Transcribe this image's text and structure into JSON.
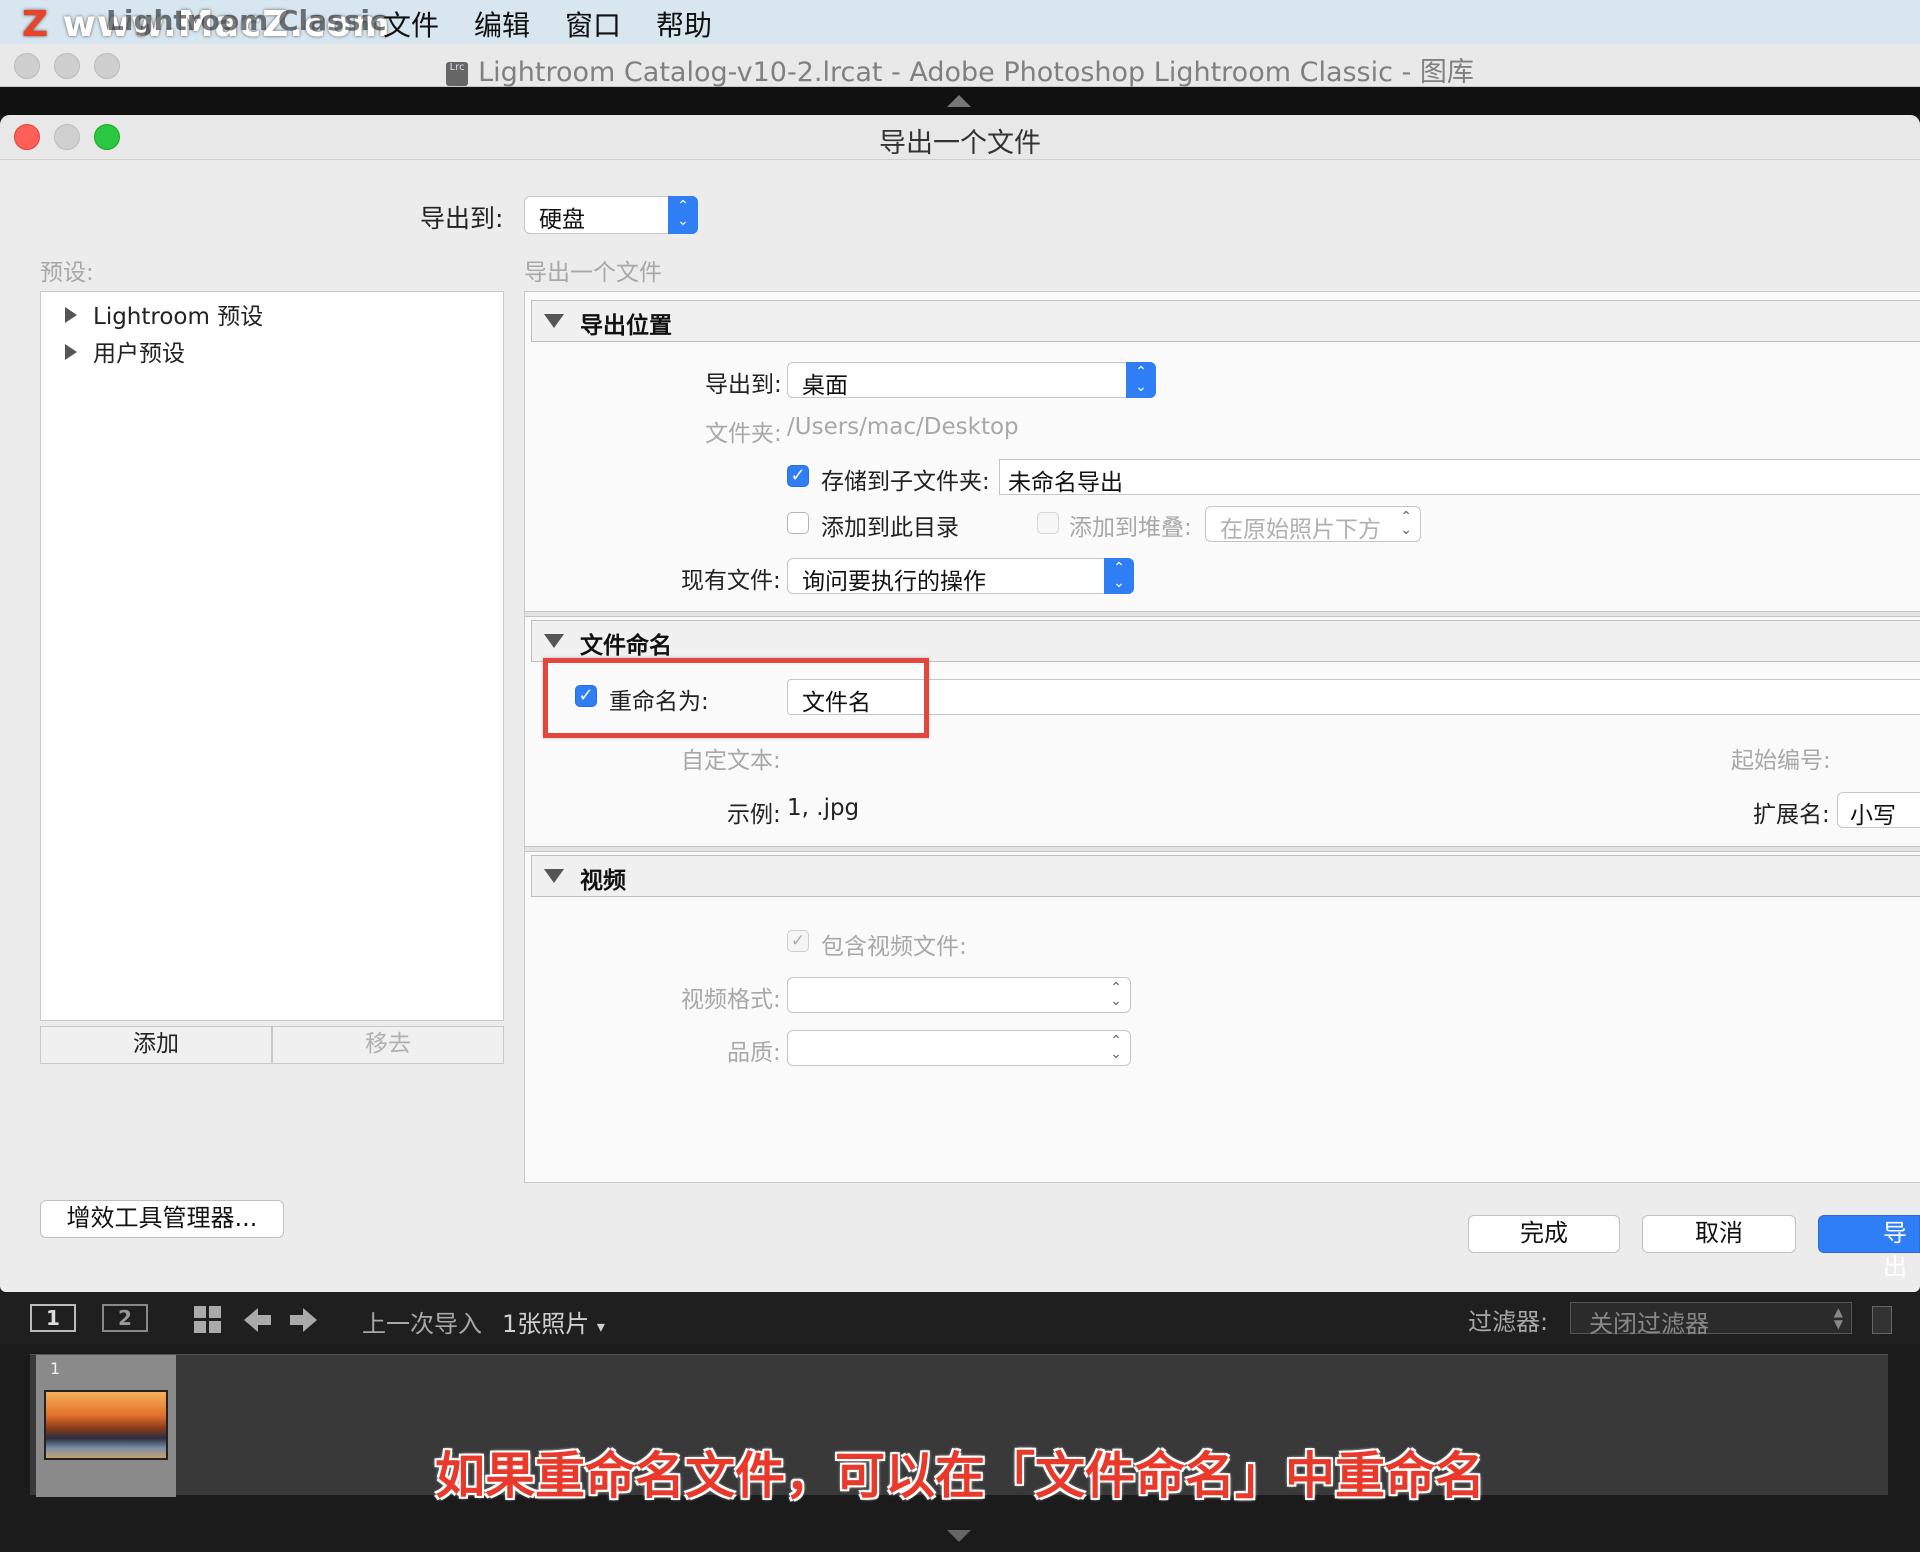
{
  "menubar": {
    "app_name": "Lightroom Classic",
    "watermark": "www.MacZ.com",
    "items": [
      "文件",
      "编辑",
      "窗口",
      "帮助"
    ]
  },
  "main_window": {
    "title": "Lightroom Catalog-v10-2.lrcat - Adobe Photoshop Lightroom Classic - 图库",
    "lrc_icon_text": "Lrc"
  },
  "dialog": {
    "title": "导出一个文件",
    "export_to_label": "导出到:",
    "export_to_value": "硬盘",
    "presets_label": "预设:",
    "section_caption": "导出一个文件",
    "presets": [
      "Lightroom 预设",
      "用户预设"
    ],
    "add_button": "添加",
    "remove_button": "移去",
    "plugin_manager_button": "增效工具管理器...",
    "done_button": "完成",
    "cancel_button": "取消",
    "export_button": "导出"
  },
  "export_location": {
    "header": "导出位置",
    "export_to_label": "导出到:",
    "export_to_value": "桌面",
    "folder_label": "文件夹:",
    "folder_value": "/Users/mac/Desktop",
    "subfolder_checked": true,
    "subfolder_label": "存储到子文件夹:",
    "subfolder_value": "未命名导出",
    "add_to_catalog_checked": false,
    "add_to_catalog_label": "添加到此目录",
    "add_to_stack_label": "添加到堆叠:",
    "add_to_stack_value": "在原始照片下方",
    "existing_files_label": "现有文件:",
    "existing_files_value": "询问要执行的操作"
  },
  "file_naming": {
    "header": "文件命名",
    "rename_checked": true,
    "rename_label": "重命名为:",
    "rename_value": "文件名",
    "custom_text_label": "自定文本:",
    "start_number_label": "起始编号:",
    "example_label": "示例:",
    "example_value": "1, .jpg",
    "extension_label": "扩展名:",
    "extension_value": "小写"
  },
  "video": {
    "header": "视频",
    "include_video_checked": true,
    "include_video_label": "包含视频文件:",
    "video_format_label": "视频格式:",
    "quality_label": "品质:"
  },
  "filmstrip": {
    "screen1": "1",
    "screen2": "2",
    "source": "上一次导入",
    "count": "1张照片",
    "filter_label": "过滤器:",
    "filter_value": "关闭过滤器",
    "thumb_index": "1"
  },
  "caption": "如果重命名文件，可以在「文件命名」中重命名",
  "colors": {
    "accent_blue": "#2f7ef5",
    "highlight_red": "#e2473d",
    "caption_red": "#e8392a"
  }
}
